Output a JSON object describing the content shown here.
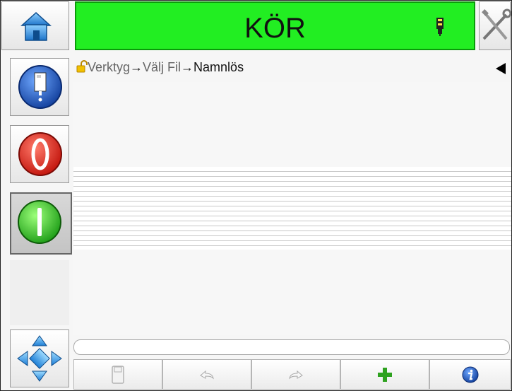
{
  "header": {
    "status_label": "KÖR",
    "status_color": "#22ee22",
    "home_icon": "home-icon",
    "ink_icon": "ink-cartridge-icon",
    "tools_icon": "tools-icon"
  },
  "breadcrumb": {
    "items": [
      "Verktyg",
      "Välj Fil",
      "Namnlös"
    ],
    "separator": "→",
    "lock_icon": "padlock-open-icon"
  },
  "sidebar": {
    "items": [
      {
        "name": "ink-system-button",
        "icon": "ink-bottle-icon"
      },
      {
        "name": "stop-button",
        "icon": "stop-icon"
      },
      {
        "name": "start-button",
        "icon": "start-icon",
        "pressed": true
      },
      {
        "name": "empty-slot",
        "icon": ""
      },
      {
        "name": "navigation-button",
        "icon": "directional-arrows-icon"
      }
    ]
  },
  "toolbar": {
    "buttons": [
      {
        "name": "save-button",
        "icon": "save-icon",
        "enabled": false
      },
      {
        "name": "undo-button",
        "icon": "undo-icon",
        "enabled": false
      },
      {
        "name": "redo-button",
        "icon": "redo-icon",
        "enabled": false
      },
      {
        "name": "add-button",
        "icon": "plus-icon",
        "enabled": true
      },
      {
        "name": "info-button",
        "icon": "info-icon",
        "enabled": true
      }
    ]
  },
  "input": {
    "value": ""
  }
}
